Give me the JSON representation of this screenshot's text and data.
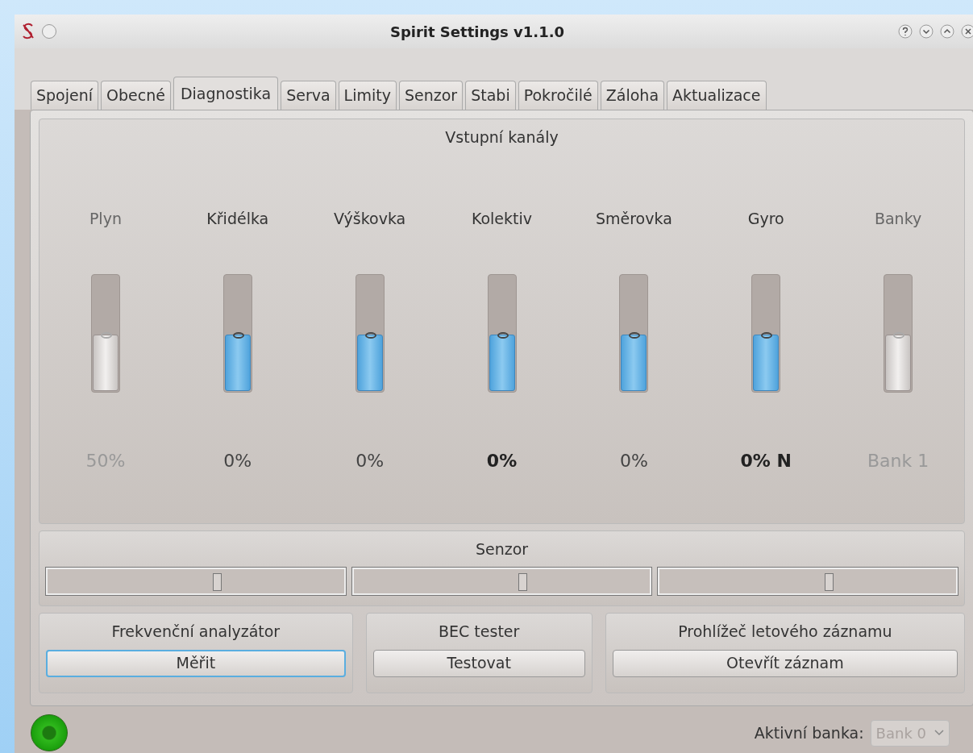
{
  "window": {
    "title": "Spirit Settings v1.1.0"
  },
  "tabs": [
    {
      "label": "Spojení",
      "selected": false
    },
    {
      "label": "Obecné",
      "selected": false
    },
    {
      "label": "Diagnostika",
      "selected": true
    },
    {
      "label": "Serva",
      "selected": false
    },
    {
      "label": "Limity",
      "selected": false
    },
    {
      "label": "Senzor",
      "selected": false
    },
    {
      "label": "Stabi",
      "selected": false
    },
    {
      "label": "Pokročilé",
      "selected": false
    },
    {
      "label": "Záloha",
      "selected": false
    },
    {
      "label": "Aktualizace",
      "selected": false
    }
  ],
  "input_channels": {
    "title": "Vstupní kanály",
    "channels": [
      {
        "name": "Plyn",
        "level": 0.5,
        "disabled": true,
        "reading": "50%",
        "bold": false
      },
      {
        "name": "Křidélka",
        "level": 0.5,
        "disabled": false,
        "reading": "0%",
        "bold": false
      },
      {
        "name": "Výškovka",
        "level": 0.5,
        "disabled": false,
        "reading": "0%",
        "bold": false
      },
      {
        "name": "Kolektiv",
        "level": 0.5,
        "disabled": false,
        "reading": "0%",
        "bold": true
      },
      {
        "name": "Směrovka",
        "level": 0.5,
        "disabled": false,
        "reading": "0%",
        "bold": false
      },
      {
        "name": "Gyro",
        "level": 0.5,
        "disabled": false,
        "reading": "0% N",
        "bold": true
      },
      {
        "name": "Banky",
        "level": 0.5,
        "disabled": true,
        "reading": "Bank 1",
        "bold": false
      }
    ]
  },
  "sensor": {
    "title": "Senzor",
    "sliders": [
      {
        "level": 0.57
      },
      {
        "level": 0.57
      },
      {
        "level": 0.57
      }
    ]
  },
  "tools": [
    {
      "title": "Frekvenční analyzátor",
      "button": "Měřit",
      "focused": true
    },
    {
      "title": "BEC tester",
      "button": "Testovat",
      "focused": false
    },
    {
      "title": "Prohlížeč letového záznamu",
      "button": "Otevřít záznam",
      "focused": false
    }
  ],
  "status": {
    "connected": true,
    "bank_label": "Aktivní banka:",
    "bank_value": "Bank 0",
    "bank_disabled": true
  }
}
